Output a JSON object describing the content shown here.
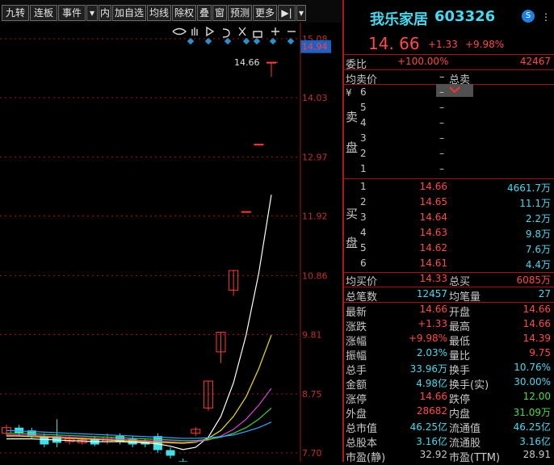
{
  "toolbar": {
    "buttons": [
      "九转",
      "连板",
      "事件",
      "▾",
      "内",
      "加自选",
      "均线",
      "除权",
      "叠",
      "窗",
      "预测",
      "更多",
      "▶|",
      "▾"
    ]
  },
  "chart_data": {
    "type": "candlestick",
    "y_ticks": [
      "15.08",
      "14.94",
      "14.03",
      "12.97",
      "11.92",
      "10.86",
      "9.81",
      "8.75",
      "7.70"
    ],
    "highlight_price": "14.94",
    "last_price_label": "14.66",
    "ylim": [
      7.7,
      15.08
    ],
    "candles": [
      {
        "o": 8.05,
        "c": 8.15,
        "h": 8.2,
        "l": 8.0
      },
      {
        "o": 8.15,
        "c": 8.05,
        "h": 8.2,
        "l": 8.0
      },
      {
        "o": 8.1,
        "c": 8.0,
        "h": 8.15,
        "l": 7.95
      },
      {
        "o": 8.0,
        "c": 7.85,
        "h": 8.05,
        "l": 7.8
      },
      {
        "o": 8.0,
        "c": 7.88,
        "h": 8.3,
        "l": 7.8
      },
      {
        "o": 7.9,
        "c": 7.95,
        "h": 8.0,
        "l": 7.85
      },
      {
        "o": 7.88,
        "c": 7.93,
        "h": 7.98,
        "l": 7.85
      },
      {
        "o": 7.95,
        "c": 7.85,
        "h": 8.0,
        "l": 7.82
      },
      {
        "o": 7.9,
        "c": 7.98,
        "h": 8.05,
        "l": 7.85
      },
      {
        "o": 8.0,
        "c": 7.9,
        "h": 8.05,
        "l": 7.85
      },
      {
        "o": 7.95,
        "c": 7.85,
        "h": 8.0,
        "l": 7.8
      },
      {
        "o": 7.9,
        "c": 7.85,
        "h": 7.95,
        "l": 7.8
      },
      {
        "o": 8.0,
        "c": 7.75,
        "h": 8.05,
        "l": 7.7
      },
      {
        "o": 7.75,
        "c": 7.65,
        "h": 7.8,
        "l": 7.6
      },
      {
        "o": 7.55,
        "c": 7.48,
        "h": 7.6,
        "l": 7.45
      },
      {
        "o": 8.05,
        "c": 8.12,
        "h": 8.16,
        "l": 8.0
      },
      {
        "o": 8.5,
        "c": 8.98,
        "h": 8.98,
        "l": 8.45
      },
      {
        "o": 9.5,
        "c": 9.85,
        "h": 9.85,
        "l": 9.3
      },
      {
        "o": 10.6,
        "c": 10.95,
        "h": 10.95,
        "l": 10.5
      },
      {
        "o": 12.0,
        "c": 12.0,
        "h": 12.0,
        "l": 12.0
      },
      {
        "o": 13.2,
        "c": 13.2,
        "h": 13.2,
        "l": 13.2
      },
      {
        "o": 14.66,
        "c": 14.66,
        "h": 14.66,
        "l": 14.4
      }
    ],
    "ma": [
      {
        "color": "#ffffff",
        "values": [
          7.95,
          7.95,
          7.95,
          7.94,
          7.93,
          7.92,
          7.91,
          7.9,
          7.9,
          7.9,
          7.89,
          7.88,
          7.86,
          7.82,
          7.76,
          7.8,
          7.98,
          8.35,
          8.95,
          9.8,
          10.9,
          12.3
        ]
      },
      {
        "color": "#f0e000",
        "values": [
          8.0,
          8.0,
          7.99,
          7.98,
          7.97,
          7.96,
          7.95,
          7.94,
          7.93,
          7.92,
          7.91,
          7.9,
          7.89,
          7.88,
          7.87,
          7.89,
          7.96,
          8.1,
          8.35,
          8.7,
          9.2,
          9.8
        ]
      },
      {
        "color": "#e040e0",
        "values": [
          8.02,
          8.02,
          8.01,
          8.0,
          7.99,
          7.98,
          7.97,
          7.96,
          7.95,
          7.94,
          7.93,
          7.92,
          7.91,
          7.9,
          7.89,
          7.9,
          7.93,
          8.0,
          8.12,
          8.3,
          8.55,
          8.85
        ]
      },
      {
        "color": "#40d040",
        "values": [
          8.05,
          8.05,
          8.04,
          8.03,
          8.02,
          8.01,
          8.0,
          7.99,
          7.98,
          7.97,
          7.96,
          7.95,
          7.94,
          7.93,
          7.92,
          7.92,
          7.94,
          7.98,
          8.05,
          8.15,
          8.3,
          8.5
        ]
      },
      {
        "color": "#40a0ff",
        "values": [
          8.1,
          8.09,
          8.08,
          8.07,
          8.06,
          8.05,
          8.04,
          8.03,
          8.02,
          8.01,
          8.0,
          7.99,
          7.98,
          7.97,
          7.96,
          7.96,
          7.97,
          7.99,
          8.02,
          8.08,
          8.15,
          8.25
        ]
      }
    ]
  },
  "stock": {
    "name": "我乐家居",
    "code": "603326",
    "price": "14. 66",
    "change": "+1.33",
    "pct": "+9.98%"
  },
  "weibi": {
    "label": "委比",
    "pct": "+100.00%",
    "value": "42467"
  },
  "avg_sell": {
    "label": "均卖价",
    "value": "–",
    "total_label": "总卖"
  },
  "sell_side_label": [
    "卖",
    "盘"
  ],
  "buy_side_label": [
    "买",
    "盘"
  ],
  "sell_levels": [
    {
      "n": "6",
      "p": "–"
    },
    {
      "n": "5",
      "p": "–"
    },
    {
      "n": "4",
      "p": "–"
    },
    {
      "n": "3",
      "p": "–"
    },
    {
      "n": "2",
      "p": "–"
    },
    {
      "n": "1",
      "p": "–"
    }
  ],
  "yen_symbol": "¥",
  "buy_levels": [
    {
      "n": "1",
      "p": "14.66",
      "v": "4661.7万"
    },
    {
      "n": "2",
      "p": "14.65",
      "v": "11.1万"
    },
    {
      "n": "3",
      "p": "14.64",
      "v": "2.2万"
    },
    {
      "n": "4",
      "p": "14.63",
      "v": "9.8万"
    },
    {
      "n": "5",
      "p": "14.62",
      "v": "7.6万"
    },
    {
      "n": "6",
      "p": "14.61",
      "v": "4.4万"
    }
  ],
  "avg_buy": {
    "label": "均买价",
    "value": "14.33",
    "total_label": "总买",
    "total": "6085万"
  },
  "total_trades": {
    "label": "总笔数",
    "value": "12457",
    "avg_label": "均笔量",
    "avg": "27"
  },
  "stats": [
    [
      "最新",
      "14.66",
      "red",
      "开盘",
      "14.66",
      "red"
    ],
    [
      "涨跌",
      "+1.33",
      "red",
      "最高",
      "14.66",
      "red"
    ],
    [
      "涨幅",
      "+9.98%",
      "red",
      "最低",
      "14.39",
      "red"
    ],
    [
      "振幅",
      "2.03%",
      "cyan",
      "量比",
      "9.75",
      "red"
    ],
    [
      "总手",
      "33.96万",
      "cyan",
      "换手",
      "10.76%",
      "cyan"
    ],
    [
      "金额",
      "4.98亿",
      "cyan",
      "换手(实)",
      "30.00%",
      "cyan"
    ],
    [
      "涨停",
      "14.66",
      "red",
      "跌停",
      "12.00",
      "green"
    ],
    [
      "外盘",
      "28682",
      "red",
      "内盘",
      "31.09万",
      "green"
    ],
    [
      "总市值",
      "46.25亿",
      "cyan",
      "流通值",
      "46.25亿",
      "cyan"
    ],
    [
      "总股本",
      "3.16亿",
      "cyan",
      "流通股",
      "3.16亿",
      "cyan"
    ],
    [
      "市盈(静)",
      "32.92",
      "gray",
      "市盈(TTM)",
      "28.91",
      "gray"
    ]
  ]
}
